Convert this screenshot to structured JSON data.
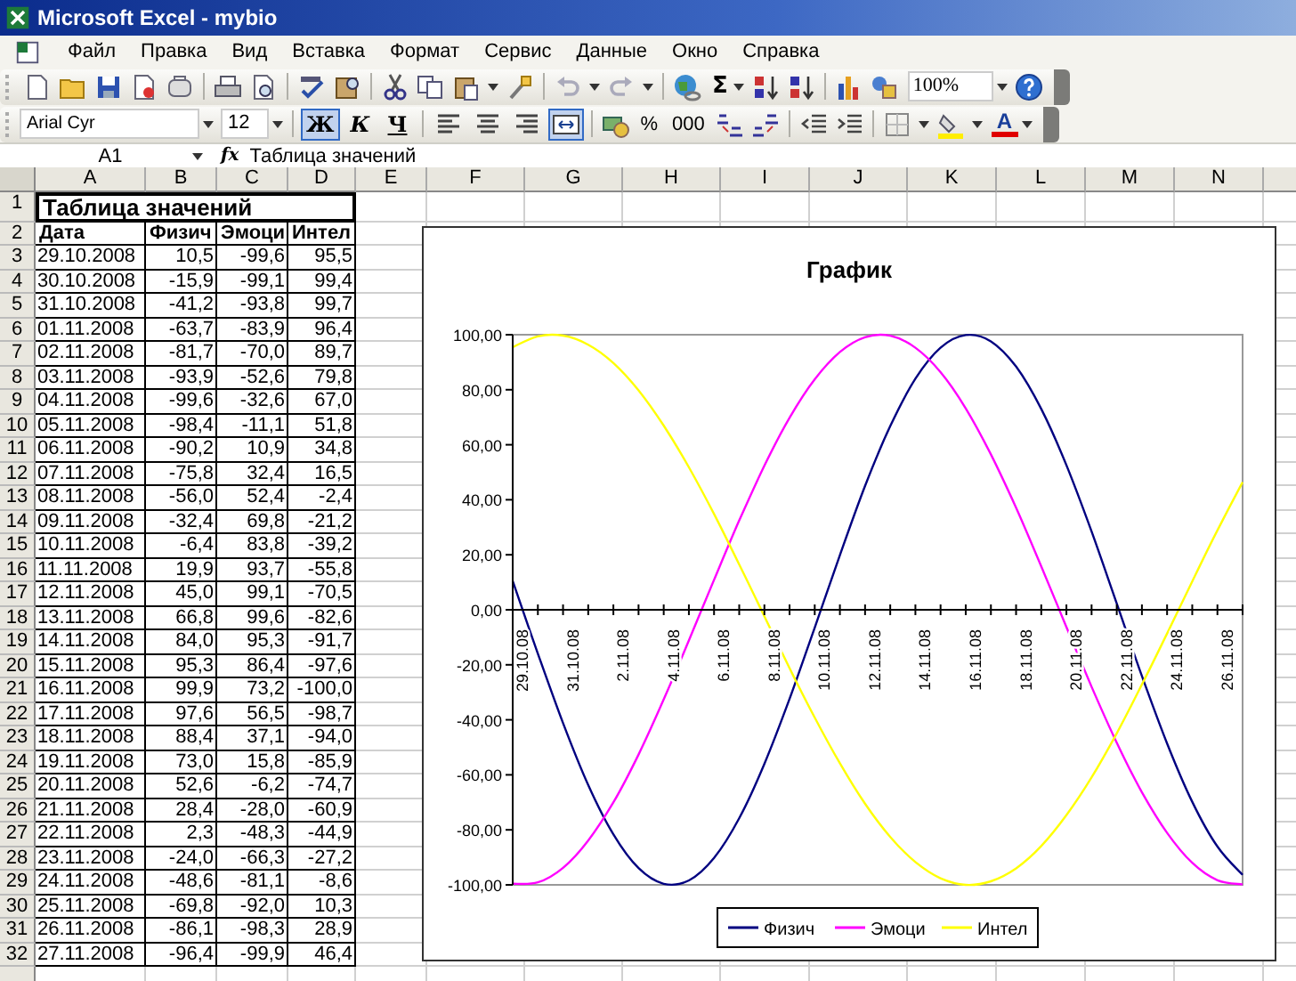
{
  "window": {
    "title": "Microsoft Excel - mybio"
  },
  "menu": [
    "Файл",
    "Правка",
    "Вид",
    "Вставка",
    "Формат",
    "Сервис",
    "Данные",
    "Окно",
    "Справка"
  ],
  "standard_toolbar": {
    "sum_label": "Σ",
    "zoom": "100%"
  },
  "formatting_toolbar": {
    "font": "Arial Cyr",
    "size": "12",
    "style_buttons": [
      {
        "label": "Ж",
        "kind": "bold",
        "on": true
      },
      {
        "label": "К",
        "kind": "italic",
        "on": false
      },
      {
        "label": "Ч",
        "kind": "underline",
        "on": false
      }
    ],
    "align_buttons": [
      {
        "kind": "left",
        "on": false
      },
      {
        "kind": "center",
        "on": false
      },
      {
        "kind": "right",
        "on": false
      },
      {
        "kind": "merge",
        "on": true
      }
    ],
    "number_labels": [
      "%",
      "000"
    ],
    "font_color_label": "A"
  },
  "formula_bar": {
    "name_box": "A1",
    "fx_label": "fx",
    "value": "Таблица значений"
  },
  "sheet": {
    "columns": [
      "A",
      "B",
      "C",
      "D",
      "E",
      "F",
      "G",
      "H",
      "I",
      "J",
      "K",
      "L",
      "M",
      "N"
    ],
    "row_headers": [
      "1",
      "2",
      "3",
      "4",
      "5",
      "6",
      "7",
      "8",
      "9",
      "10",
      "11",
      "12",
      "13",
      "14",
      "15",
      "16",
      "17",
      "18",
      "19",
      "20",
      "21",
      "22",
      "23",
      "24",
      "25",
      "26",
      "27",
      "28",
      "29",
      "30",
      "31",
      "32"
    ],
    "title": "Таблица значений",
    "headers": [
      "Дата",
      "Физич",
      "Эмоци",
      "Интел"
    ],
    "rows": [
      [
        "29.10.2008",
        "10,5",
        "-99,6",
        "95,5"
      ],
      [
        "30.10.2008",
        "-15,9",
        "-99,1",
        "99,4"
      ],
      [
        "31.10.2008",
        "-41,2",
        "-93,8",
        "99,7"
      ],
      [
        "01.11.2008",
        "-63,7",
        "-83,9",
        "96,4"
      ],
      [
        "02.11.2008",
        "-81,7",
        "-70,0",
        "89,7"
      ],
      [
        "03.11.2008",
        "-93,9",
        "-52,6",
        "79,8"
      ],
      [
        "04.11.2008",
        "-99,6",
        "-32,6",
        "67,0"
      ],
      [
        "05.11.2008",
        "-98,4",
        "-11,1",
        "51,8"
      ],
      [
        "06.11.2008",
        "-90,2",
        "10,9",
        "34,8"
      ],
      [
        "07.11.2008",
        "-75,8",
        "32,4",
        "16,5"
      ],
      [
        "08.11.2008",
        "-56,0",
        "52,4",
        "-2,4"
      ],
      [
        "09.11.2008",
        "-32,4",
        "69,8",
        "-21,2"
      ],
      [
        "10.11.2008",
        "-6,4",
        "83,8",
        "-39,2"
      ],
      [
        "11.11.2008",
        "19,9",
        "93,7",
        "-55,8"
      ],
      [
        "12.11.2008",
        "45,0",
        "99,1",
        "-70,5"
      ],
      [
        "13.11.2008",
        "66,8",
        "99,6",
        "-82,6"
      ],
      [
        "14.11.2008",
        "84,0",
        "95,3",
        "-91,7"
      ],
      [
        "15.11.2008",
        "95,3",
        "86,4",
        "-97,6"
      ],
      [
        "16.11.2008",
        "99,9",
        "73,2",
        "-100,0"
      ],
      [
        "17.11.2008",
        "97,6",
        "56,5",
        "-98,7"
      ],
      [
        "18.11.2008",
        "88,4",
        "37,1",
        "-94,0"
      ],
      [
        "19.11.2008",
        "73,0",
        "15,8",
        "-85,9"
      ],
      [
        "20.11.2008",
        "52,6",
        "-6,2",
        "-74,7"
      ],
      [
        "21.11.2008",
        "28,4",
        "-28,0",
        "-60,9"
      ],
      [
        "22.11.2008",
        "2,3",
        "-48,3",
        "-44,9"
      ],
      [
        "23.11.2008",
        "-24,0",
        "-66,3",
        "-27,2"
      ],
      [
        "24.11.2008",
        "-48,6",
        "-81,1",
        "-8,6"
      ],
      [
        "25.11.2008",
        "-69,8",
        "-92,0",
        "10,3"
      ],
      [
        "26.11.2008",
        "-86,1",
        "-98,3",
        "28,9"
      ],
      [
        "27.11.2008",
        "-96,4",
        "-99,9",
        "46,4"
      ]
    ]
  },
  "chart": {
    "chart_data": {
      "type": "line",
      "title": "График",
      "categories": [
        "29.10.08",
        null,
        "31.10.08",
        null,
        "2.11.08",
        null,
        "4.11.08",
        null,
        "6.11.08",
        null,
        "8.11.08",
        null,
        "10.11.08",
        null,
        "12.11.08",
        null,
        "14.11.08",
        null,
        "16.11.08",
        null,
        "18.11.08",
        null,
        "20.11.08",
        null,
        "22.11.08",
        null,
        "24.11.08",
        null,
        "26.11.08",
        null
      ],
      "series": [
        {
          "name": "Физич",
          "color": "#000080",
          "values": [
            10.5,
            -15.9,
            -41.2,
            -63.7,
            -81.7,
            -93.9,
            -99.6,
            -98.4,
            -90.2,
            -75.8,
            -56.0,
            -32.4,
            -6.4,
            19.9,
            45.0,
            66.8,
            84.0,
            95.3,
            99.9,
            97.6,
            88.4,
            73.0,
            52.6,
            28.4,
            2.3,
            -24.0,
            -48.6,
            -69.8,
            -86.1,
            -96.4
          ]
        },
        {
          "name": "Эмоци",
          "color": "#ff00ff",
          "values": [
            -99.6,
            -99.1,
            -93.8,
            -83.9,
            -70.0,
            -52.6,
            -32.6,
            -11.1,
            10.9,
            32.4,
            52.4,
            69.8,
            83.8,
            93.7,
            99.1,
            99.6,
            95.3,
            86.4,
            73.2,
            56.5,
            37.1,
            15.8,
            -6.2,
            -28.0,
            -48.3,
            -66.3,
            -81.1,
            -92.0,
            -98.3,
            -99.9
          ]
        },
        {
          "name": "Интел",
          "color": "#ffff00",
          "values": [
            95.5,
            99.4,
            99.7,
            96.4,
            89.7,
            79.8,
            67.0,
            51.8,
            34.8,
            16.5,
            -2.4,
            -21.2,
            -39.2,
            -55.8,
            -70.5,
            -82.6,
            -91.7,
            -97.6,
            -100.0,
            -98.7,
            -94.0,
            -85.9,
            -74.7,
            -60.9,
            -44.9,
            -27.2,
            -8.6,
            10.3,
            28.9,
            46.4
          ]
        }
      ],
      "ylim": [
        -100,
        100
      ],
      "legend": "bottom",
      "yticks": [
        {
          "value": 100,
          "label": "100,00"
        },
        {
          "value": 80,
          "label": "80,00"
        },
        {
          "value": 60,
          "label": "60,00"
        },
        {
          "value": 40,
          "label": "40,00"
        },
        {
          "value": 20,
          "label": "20,00"
        },
        {
          "value": 0,
          "label": "0,00"
        },
        {
          "value": -20,
          "label": "-20,00"
        },
        {
          "value": -40,
          "label": "-40,00"
        },
        {
          "value": -60,
          "label": "-60,00"
        },
        {
          "value": -80,
          "label": "-80,00"
        },
        {
          "value": -100,
          "label": "-100,00"
        }
      ]
    }
  }
}
